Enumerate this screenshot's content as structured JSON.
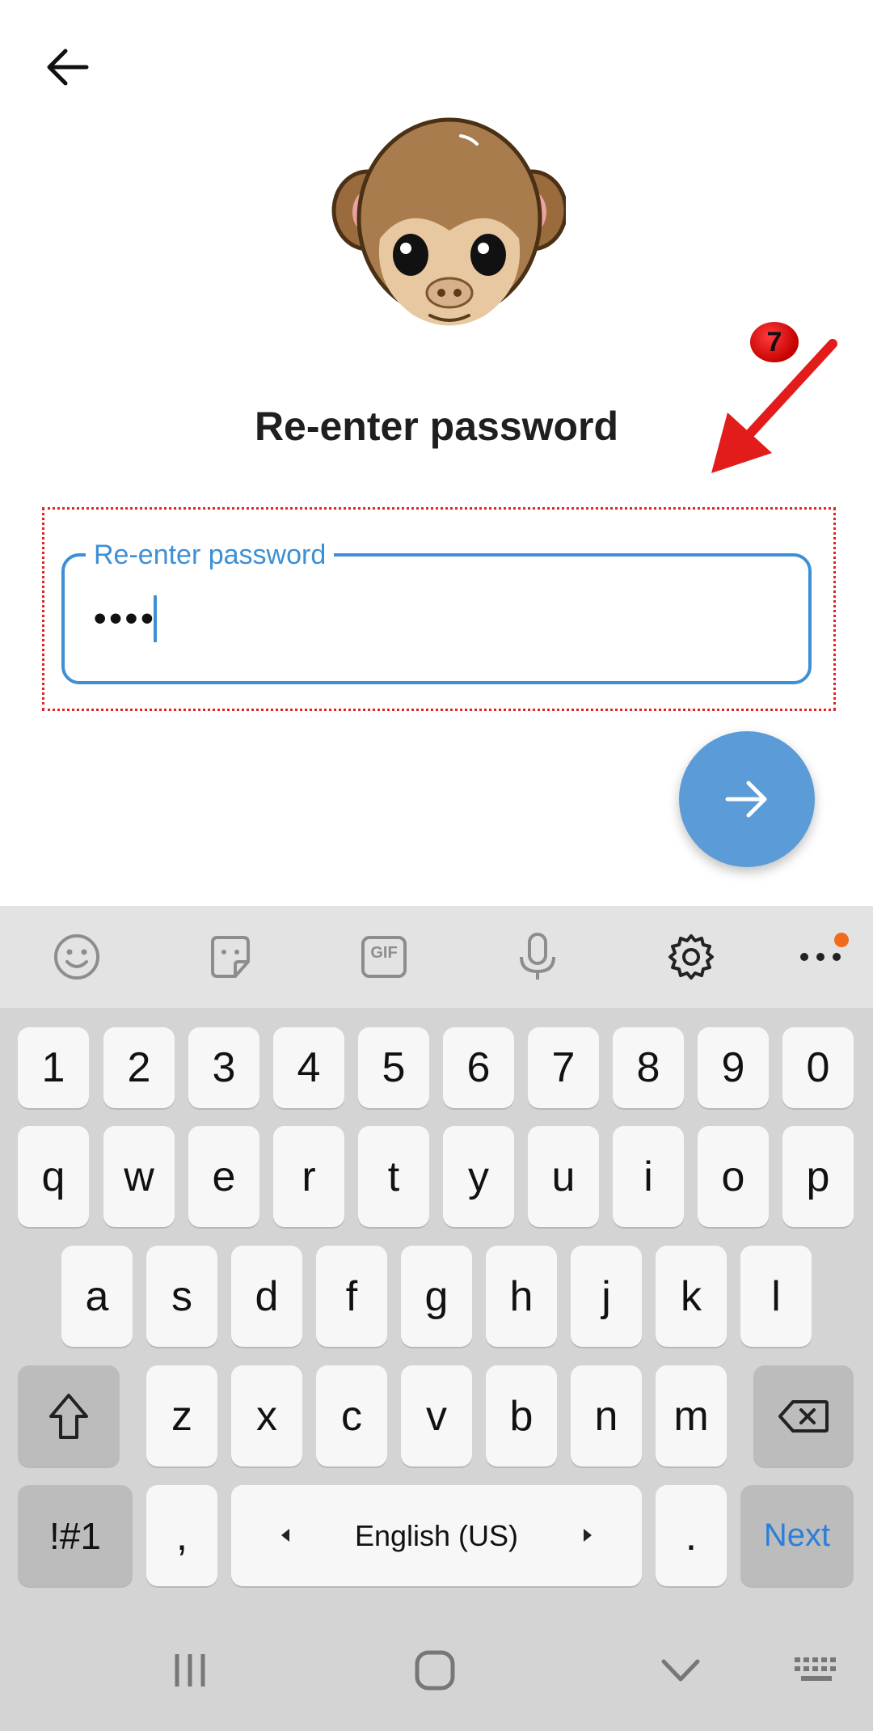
{
  "header": {
    "back_icon": "arrow-left-icon"
  },
  "illustration": {
    "name": "monkey-face-icon"
  },
  "page": {
    "title": "Re-enter password"
  },
  "annotation": {
    "step_number": "7",
    "color": "#e02424"
  },
  "password_field": {
    "label": "Re-enter password",
    "value": "••••",
    "accent": "#3d8fd6"
  },
  "next_button": {
    "icon": "arrow-right-icon",
    "color": "#5b9bd8"
  },
  "keyboard": {
    "toolbar": [
      "emoji-icon",
      "sticker-icon",
      "gif-icon",
      "microphone-icon",
      "settings-gear-icon",
      "more-icon"
    ],
    "gif_label": "GIF",
    "row_numbers": [
      "1",
      "2",
      "3",
      "4",
      "5",
      "6",
      "7",
      "8",
      "9",
      "0"
    ],
    "row_q": [
      "q",
      "w",
      "e",
      "r",
      "t",
      "y",
      "u",
      "i",
      "o",
      "p"
    ],
    "row_a": [
      "a",
      "s",
      "d",
      "f",
      "g",
      "h",
      "j",
      "k",
      "l"
    ],
    "row_z": [
      "z",
      "x",
      "c",
      "v",
      "b",
      "n",
      "m"
    ],
    "symbols_key": "!#1",
    "comma_key": ",",
    "space_label": "English (US)",
    "period_key": ".",
    "action_key": "Next",
    "action_color": "#2b7fd8"
  },
  "navbar": [
    "recents-icon",
    "home-icon",
    "back-chevron-icon",
    "keyboard-switch-icon"
  ]
}
